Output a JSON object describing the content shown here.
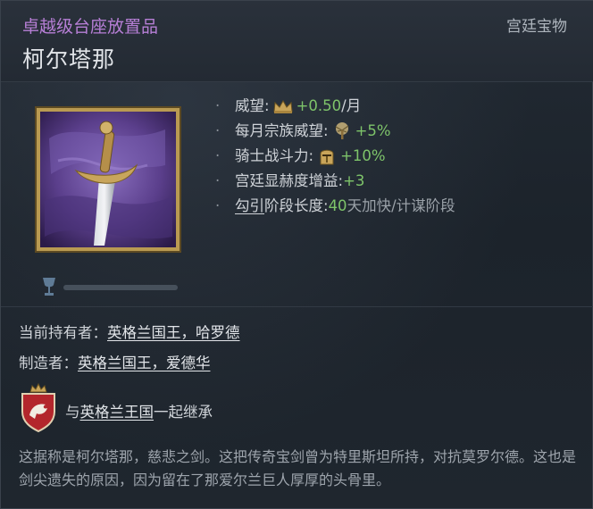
{
  "header": {
    "rarity": "卓越级台座放置品",
    "category": "宫廷宝物",
    "item_name": "柯尔塔那"
  },
  "wealth_bar": {
    "fill": 1.0
  },
  "modifiers": [
    {
      "bullet": "·",
      "label": "威望:",
      "icon": "crown-icon",
      "value": "+0.50",
      "suffix": "/月"
    },
    {
      "bullet": "·",
      "label": "每月宗族威望:",
      "icon": "tree-icon",
      "value": "+5%"
    },
    {
      "bullet": "·",
      "label": "骑士战斗力:",
      "icon": "knight-helmet-icon",
      "value": "+10%"
    },
    {
      "bullet": "·",
      "label": "宫廷显赫度增益:",
      "value": "+3"
    },
    {
      "bullet": "·",
      "link": "勾引",
      "label": "阶段长度:",
      "value": "40",
      "suffix": "天加快/计谋阶段"
    }
  ],
  "owner": {
    "label": "当前持有者：",
    "name": "英格兰国王，哈罗德"
  },
  "creator": {
    "label": "制造者：",
    "name": "英格兰国王，爱德华"
  },
  "inheritance": {
    "prefix": "与",
    "title": "英格兰王国",
    "suffix": "一起继承"
  },
  "description": "这据称是柯尔塔那，慈悲之剑。这把传奇宝剑曾为特里斯坦所持，对抗莫罗尔德。这也是剑尖遗失的原因，因为留在了那爱尔兰巨人厚厚的头骨里。",
  "colors": {
    "rarity": "#b77fd6",
    "positive": "#7ec46a",
    "frame_gold": "#b99a52",
    "coa_red": "#b3262c"
  }
}
